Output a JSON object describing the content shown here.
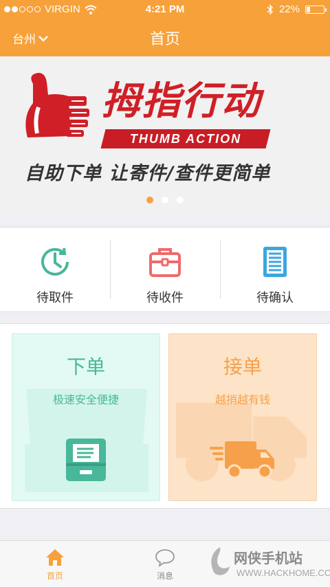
{
  "status_bar": {
    "carrier": "VIRGIN",
    "time": "4:21 PM",
    "battery": "22%",
    "battery_level": 0.22,
    "signal_bars": 2
  },
  "header": {
    "city": "台州",
    "title": "首页",
    "background_color": "#f7a13a"
  },
  "banner": {
    "title": "拇指行动",
    "subtitle": "THUMB ACTION",
    "slogan": "自助下单 让寄件/查件更简单",
    "page_count": 3,
    "active_page": 1,
    "brand_color": "#d01f26"
  },
  "status_items": [
    {
      "label": "待取件",
      "icon": "clock-icon",
      "color": "#49b79a"
    },
    {
      "label": "待收件",
      "icon": "briefcase-icon",
      "color": "#ef6a6a"
    },
    {
      "label": "待确认",
      "icon": "document-icon",
      "color": "#3aa6e0"
    }
  ],
  "cards": {
    "order": {
      "title": "下单",
      "subtitle": "极速安全便捷",
      "icon": "inbox-tray-icon",
      "color": "#49b79a"
    },
    "accept": {
      "title": "接单",
      "subtitle": "越捎越有钱",
      "icon": "delivery-truck-icon",
      "color": "#f6a14a"
    }
  },
  "tabbar": {
    "items": [
      {
        "label": "首页",
        "icon": "home-icon",
        "active": true
      },
      {
        "label": "消息",
        "icon": "chat-bubble-icon",
        "active": false
      }
    ]
  },
  "watermark": {
    "text": "网侠手机站",
    "url": "WWW.HACKHOME.COM"
  }
}
